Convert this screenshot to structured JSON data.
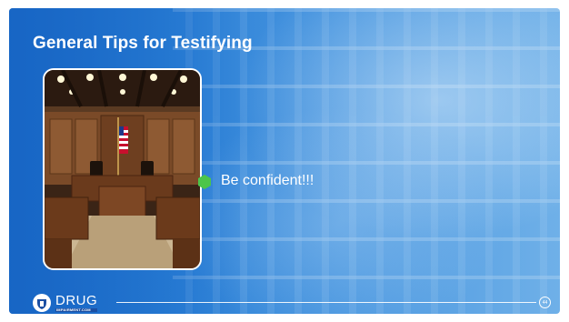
{
  "slide": {
    "title": "General Tips for Testifying",
    "bullets": [
      {
        "text": "Be confident!!!",
        "icon": "hexagon-icon",
        "color": "#4cc54a"
      }
    ],
    "image": {
      "subject": "courtroom-photo"
    },
    "background": {
      "subject": "pharmacy-shelves"
    }
  },
  "footer": {
    "logo_word": "DRUG",
    "logo_sub": "IMPAIRMENT.COM",
    "page_number": "44"
  },
  "colors": {
    "accent_blue": "#2a7fd6",
    "bullet_green": "#4cc54a",
    "text": "#ffffff"
  }
}
